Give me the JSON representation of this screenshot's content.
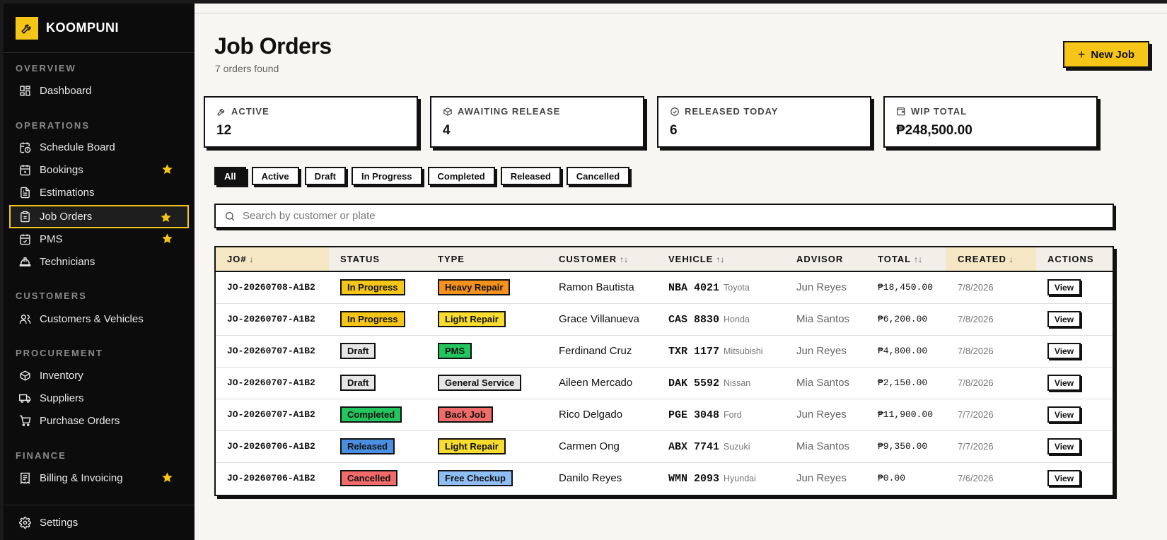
{
  "brand": {
    "name": "KOOMPUNI",
    "logo_icon": "wrench-icon",
    "accent": "#f5c518"
  },
  "sidebar": {
    "sections": [
      {
        "title": "OVERVIEW",
        "items": [
          {
            "label": "Dashboard",
            "icon": "dashboard-icon",
            "starred": false,
            "active": false
          }
        ]
      },
      {
        "title": "OPERATIONS",
        "items": [
          {
            "label": "Schedule Board",
            "icon": "calendar-clock-icon",
            "starred": false,
            "active": false
          },
          {
            "label": "Bookings",
            "icon": "calendar-plus-icon",
            "starred": true,
            "active": false
          },
          {
            "label": "Estimations",
            "icon": "document-icon",
            "starred": false,
            "active": false
          },
          {
            "label": "Job Orders",
            "icon": "clipboard-icon",
            "starred": true,
            "active": true
          },
          {
            "label": "PMS",
            "icon": "calendar-check-icon",
            "starred": true,
            "active": false
          },
          {
            "label": "Technicians",
            "icon": "hardhat-icon",
            "starred": false,
            "active": false
          }
        ]
      },
      {
        "title": "CUSTOMERS",
        "items": [
          {
            "label": "Customers & Vehicles",
            "icon": "users-icon",
            "starred": false,
            "active": false
          }
        ]
      },
      {
        "title": "PROCUREMENT",
        "items": [
          {
            "label": "Inventory",
            "icon": "box-icon",
            "starred": false,
            "active": false
          },
          {
            "label": "Suppliers",
            "icon": "truck-icon",
            "starred": false,
            "active": false
          },
          {
            "label": "Purchase Orders",
            "icon": "cart-icon",
            "starred": false,
            "active": false
          }
        ]
      },
      {
        "title": "FINANCE",
        "items": [
          {
            "label": "Billing & Invoicing",
            "icon": "invoice-icon",
            "starred": true,
            "active": false
          }
        ]
      }
    ],
    "footer": {
      "label": "Settings",
      "icon": "gear-icon"
    }
  },
  "header": {
    "title": "Job Orders",
    "subtitle": "7 orders found",
    "new_button": "New Job"
  },
  "stats": [
    {
      "label": "ACTIVE",
      "value": "12",
      "icon": "wrench-icon"
    },
    {
      "label": "AWAITING RELEASE",
      "value": "4",
      "icon": "package-icon"
    },
    {
      "label": "RELEASED TODAY",
      "value": "6",
      "icon": "check-circle-icon"
    },
    {
      "label": "WIP TOTAL",
      "value": "₱248,500.00",
      "icon": "wallet-icon"
    }
  ],
  "filters": {
    "options": [
      "All",
      "Active",
      "Draft",
      "In Progress",
      "Completed",
      "Released",
      "Cancelled"
    ],
    "selected": "All"
  },
  "search": {
    "placeholder": "Search by customer or plate",
    "value": ""
  },
  "table": {
    "columns": [
      {
        "label": "JO#",
        "sort": "↓"
      },
      {
        "label": "STATUS",
        "sort": ""
      },
      {
        "label": "TYPE",
        "sort": ""
      },
      {
        "label": "CUSTOMER",
        "sort": "↑↓"
      },
      {
        "label": "VEHICLE",
        "sort": "↑↓"
      },
      {
        "label": "ADVISOR",
        "sort": ""
      },
      {
        "label": "TOTAL",
        "sort": "↑↓"
      },
      {
        "label": "CREATED",
        "sort": "↓"
      },
      {
        "label": "ACTIONS",
        "sort": ""
      }
    ],
    "rows": [
      {
        "jo": "JO-20260708-A1B2",
        "status": "In Progress",
        "status_color": "#f5c518",
        "type": "Heavy Repair",
        "type_color": "#f5921e",
        "customer": "Ramon Bautista",
        "plate": "NBA 4021",
        "make": "Toyota",
        "advisor": "Jun Reyes",
        "total": "₱18,450.00",
        "created": "7/8/2026",
        "action": "View"
      },
      {
        "jo": "JO-20260707-A1B2",
        "status": "In Progress",
        "status_color": "#f5c518",
        "type": "Light Repair",
        "type_color": "#f9dd2e",
        "customer": "Grace Villanueva",
        "plate": "CAS 8830",
        "make": "Honda",
        "advisor": "Mia Santos",
        "total": "₱6,200.00",
        "created": "7/8/2026",
        "action": "View"
      },
      {
        "jo": "JO-20260707-A1B2",
        "status": "Draft",
        "status_color": "#e6e6e6",
        "type": "PMS",
        "type_color": "#22c55e",
        "customer": "Ferdinand Cruz",
        "plate": "TXR 1177",
        "make": "Mitsubishi",
        "advisor": "Jun Reyes",
        "total": "₱4,800.00",
        "created": "7/8/2026",
        "action": "View"
      },
      {
        "jo": "JO-20260707-A1B2",
        "status": "Draft",
        "status_color": "#e6e6e6",
        "type": "General Service",
        "type_color": "#e6e6e6",
        "customer": "Aileen Mercado",
        "plate": "DAK 5592",
        "make": "Nissan",
        "advisor": "Mia Santos",
        "total": "₱2,150.00",
        "created": "7/8/2026",
        "action": "View"
      },
      {
        "jo": "JO-20260707-A1B2",
        "status": "Completed",
        "status_color": "#22c55e",
        "type": "Back Job",
        "type_color": "#f26b6b",
        "customer": "Rico Delgado",
        "plate": "PGE 3048",
        "make": "Ford",
        "advisor": "Jun Reyes",
        "total": "₱11,900.00",
        "created": "7/7/2026",
        "action": "View"
      },
      {
        "jo": "JO-20260706-A1B2",
        "status": "Released",
        "status_color": "#4a90e2",
        "type": "Light Repair",
        "type_color": "#f9dd2e",
        "customer": "Carmen Ong",
        "plate": "ABX 7741",
        "make": "Suzuki",
        "advisor": "Mia Santos",
        "total": "₱9,350.00",
        "created": "7/7/2026",
        "action": "View"
      },
      {
        "jo": "JO-20260706-A1B2",
        "status": "Cancelled",
        "status_color": "#f26b6b",
        "type": "Free Checkup",
        "type_color": "#8fbef5",
        "customer": "Danilo Reyes",
        "plate": "WMN 2093",
        "make": "Hyundai",
        "advisor": "Jun Reyes",
        "total": "₱0.00",
        "created": "7/6/2026",
        "action": "View"
      }
    ]
  }
}
